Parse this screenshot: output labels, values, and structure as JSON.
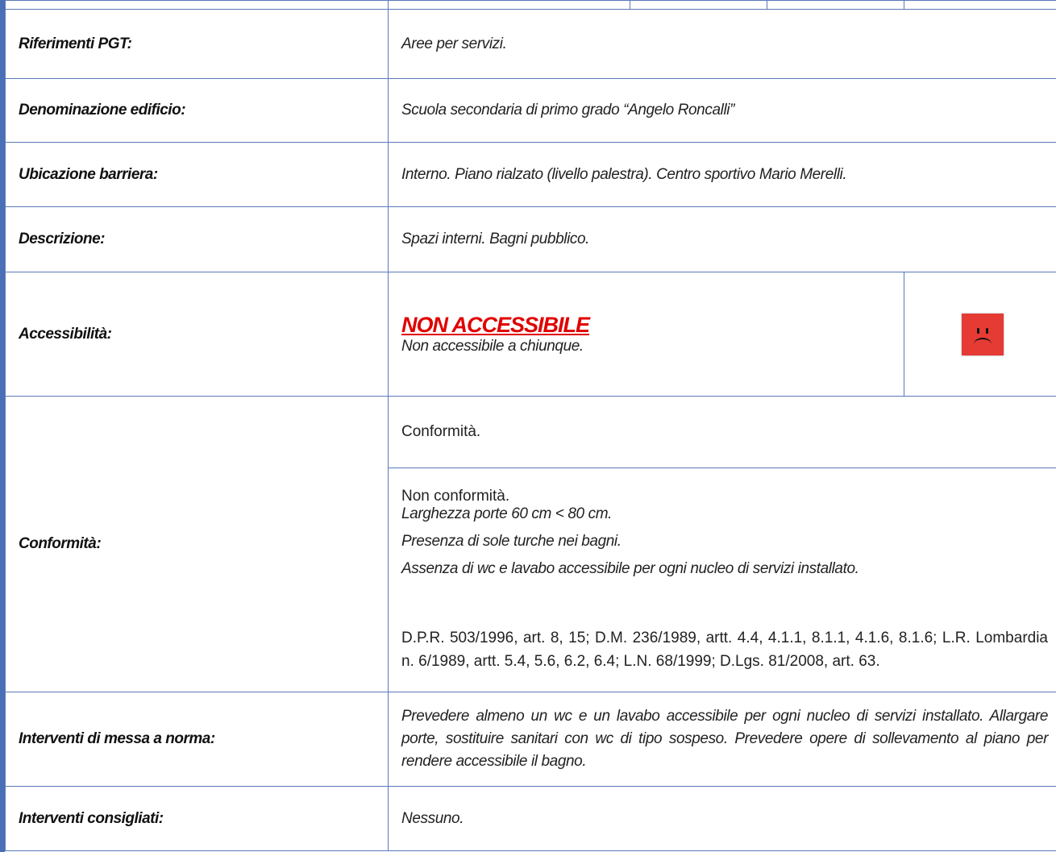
{
  "colors": {
    "border": "#5a79b8",
    "accent_red": "#e00000",
    "face_red": "#e53b34"
  },
  "rows": {
    "riferimenti": {
      "label": "Riferimenti PGT:",
      "value": "Aree per servizi."
    },
    "denominazione": {
      "label": "Denominazione edificio:",
      "value": "Scuola secondaria di primo grado “Angelo Roncalli”"
    },
    "ubicazione": {
      "label": "Ubicazione barriera:",
      "value": "Interno. Piano rialzato (livello palestra). Centro sportivo Mario Merelli."
    },
    "descrizione": {
      "label": "Descrizione:",
      "value": "Spazi interni. Bagni pubblico."
    },
    "accessibilita": {
      "label": "Accessibilità:",
      "status": "NON ACCESSIBILE",
      "note": "Non accessibile a chiunque.",
      "icon": "sad-face-icon"
    },
    "conformita": {
      "label": "Conformità:",
      "conforme_title": "Conformità.",
      "non_conforme_title": "Non conformità.",
      "items": [
        "Larghezza porte 60 cm < 80 cm.",
        "Presenza di sole turche nei bagni.",
        "Assenza di wc e lavabo accessibile per ogni nucleo di servizi installato."
      ],
      "norme": "D.P.R. 503/1996, art. 8, 15; D.M. 236/1989, artt. 4.4, 4.1.1, 8.1.1, 4.1.6, 8.1.6; L.R. Lombardia n. 6/1989, artt. 5.4, 5.6, 6.2, 6.4; L.N. 68/1999; D.Lgs. 81/2008, art. 63."
    },
    "interventi_norma": {
      "label": "Interventi di messa a norma:",
      "value": "Prevedere almeno un wc e un lavabo accessibile per ogni nucleo di servizi installato. Allargare porte, sostituire sanitari con wc di tipo sospeso. Prevedere opere di sollevamento al piano per rendere accessibile il bagno."
    },
    "interventi_consigliati": {
      "label": "Interventi consigliati:",
      "value": "Nessuno."
    }
  }
}
